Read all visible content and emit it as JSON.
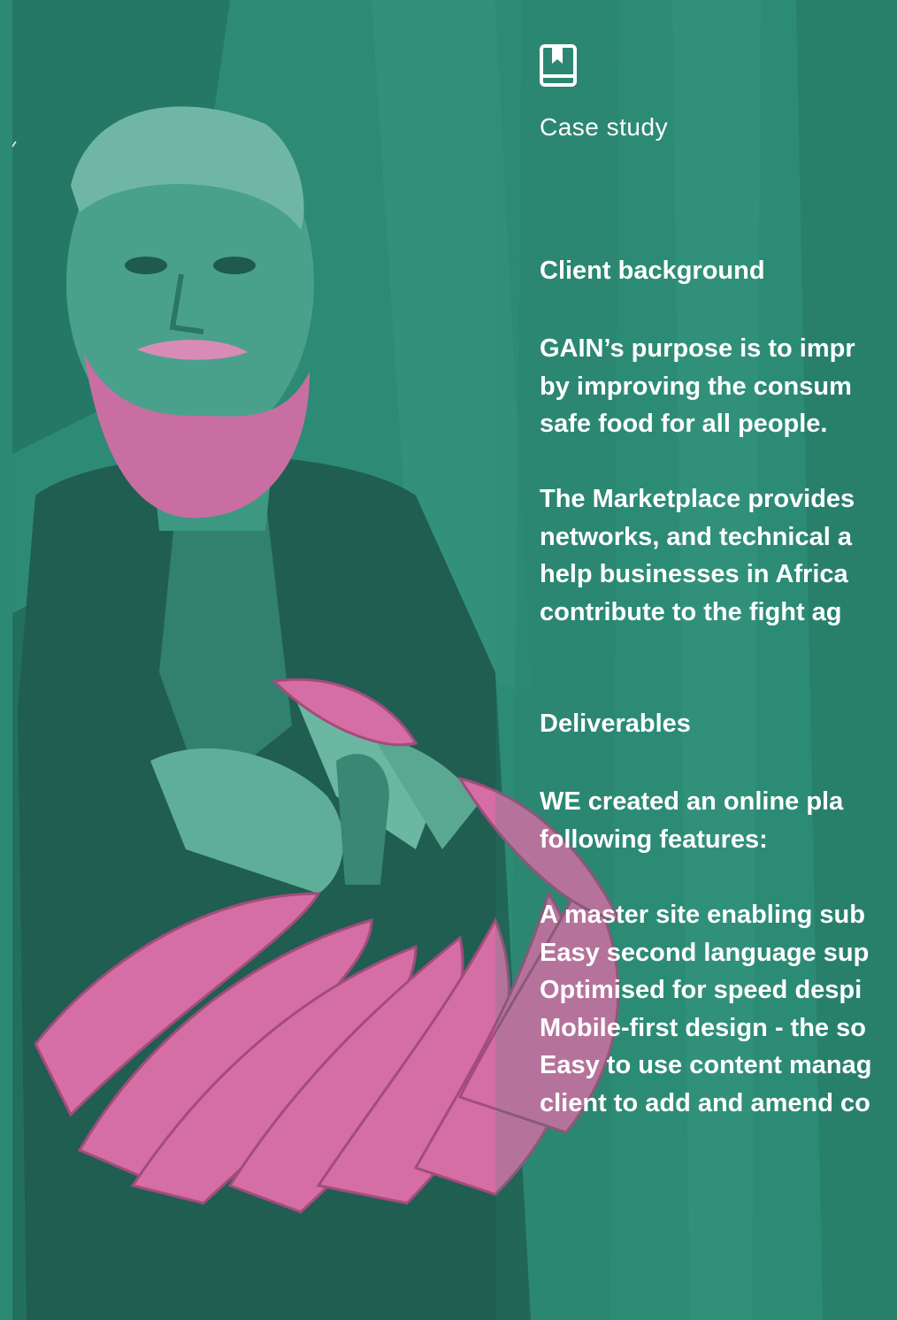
{
  "page": {
    "eyebrow": "Case study",
    "icon": "book-icon",
    "colors": {
      "teal": "#2c8a74",
      "pink": "#d46ea4",
      "text": "#ffffff"
    }
  },
  "client_background": {
    "heading": "Client background",
    "paragraph_1": {
      "lead": "GAIN",
      "line_1_rest": "’s purpose is to impr",
      "line_2": "by improving the consum",
      "line_3": "safe food for all people."
    },
    "paragraph_2": {
      "line_1": "The Marketplace provides",
      "line_2": "networks, and technical a",
      "line_3": "help businesses in Africa",
      "line_4": "contribute to the fight ag"
    }
  },
  "deliverables": {
    "heading": "Deliverables",
    "intro": {
      "lead": "WE",
      "line_1_rest": " created an online pla",
      "line_2": "following features:"
    },
    "features": [
      "A master site enabling sub",
      "Easy second language sup",
      "Optimised for speed despi",
      "Mobile-first design - the so",
      "Easy to use content manag",
      "client to add and amend co"
    ]
  }
}
